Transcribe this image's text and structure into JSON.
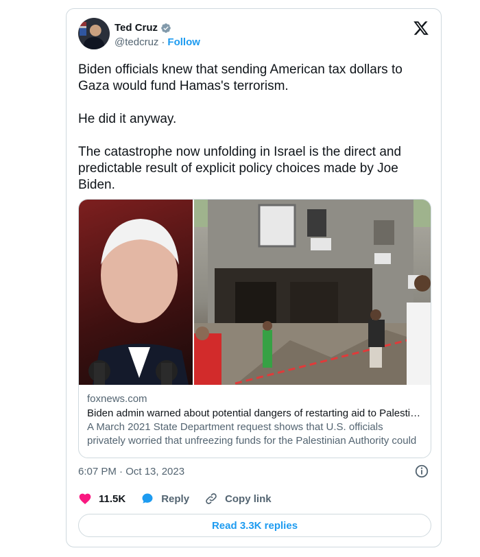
{
  "author": {
    "name": "Ted Cruz",
    "handle": "@tedcruz",
    "separator": "·",
    "follow_label": "Follow"
  },
  "tweet": {
    "text": "Biden officials knew that sending American tax dollars to Gaza would fund Hamas's terrorism.\n\nHe did it anyway.\n\nThe catastrophe now unfolding in Israel is the direct and predictable result of explicit policy choices made by Joe Biden."
  },
  "link_card": {
    "domain": "foxnews.com",
    "title": "Biden admin warned about potential dangers of restarting aid to Palestinians",
    "description": "A March 2021 State Department request shows that U.S. officials privately worried that unfreezing funds for the Palestinian Authority could indirectly benefit Hamas"
  },
  "meta": {
    "timestamp": "6:07 PM · Oct 13, 2023"
  },
  "actions": {
    "likes": "11.5K",
    "reply_label": "Reply",
    "copy_link_label": "Copy link"
  },
  "read_replies_label": "Read 3.3K replies",
  "colors": {
    "accent": "#1d9bf0",
    "like": "#f91880",
    "text_secondary": "#536471",
    "border": "#cfd9de"
  },
  "icons": [
    "verified-badge-icon",
    "x-logo-icon",
    "info-icon",
    "heart-icon",
    "reply-bubble-icon",
    "link-icon"
  ]
}
